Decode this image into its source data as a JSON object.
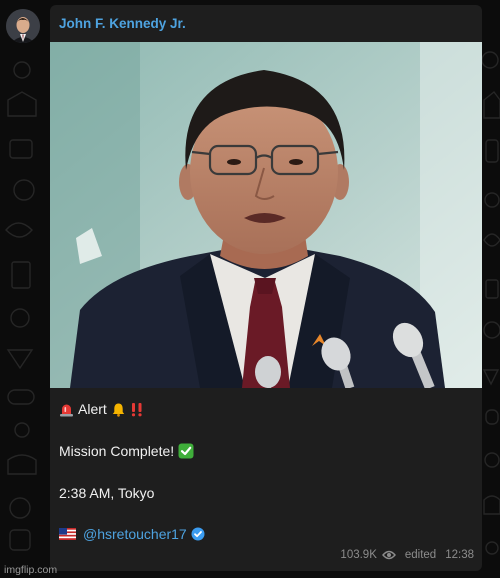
{
  "post": {
    "sender_name": "John F. Kennedy Jr.",
    "alert_label": "Alert",
    "mission_text": "Mission Complete!",
    "time_text": "2:38 AM, Tokyo",
    "handle": "@hsretoucher17",
    "views": "103.9K",
    "edited_label": "edited",
    "timestamp": "12:38"
  },
  "icons": {
    "alert_prefix": "siren-emoji",
    "alert_bell": "bell-emoji",
    "alert_exclaim": "double-exclamation-emoji",
    "mission_check": "check-mark-button-emoji",
    "handle_flag": "us-flag-emoji",
    "verified": "verified-badge-icon",
    "views": "eye-icon"
  },
  "colors": {
    "link": "#4ea3e0",
    "bubble": "#1e1e1e",
    "background": "#0c0c0c"
  },
  "watermark": "imgflip.com"
}
